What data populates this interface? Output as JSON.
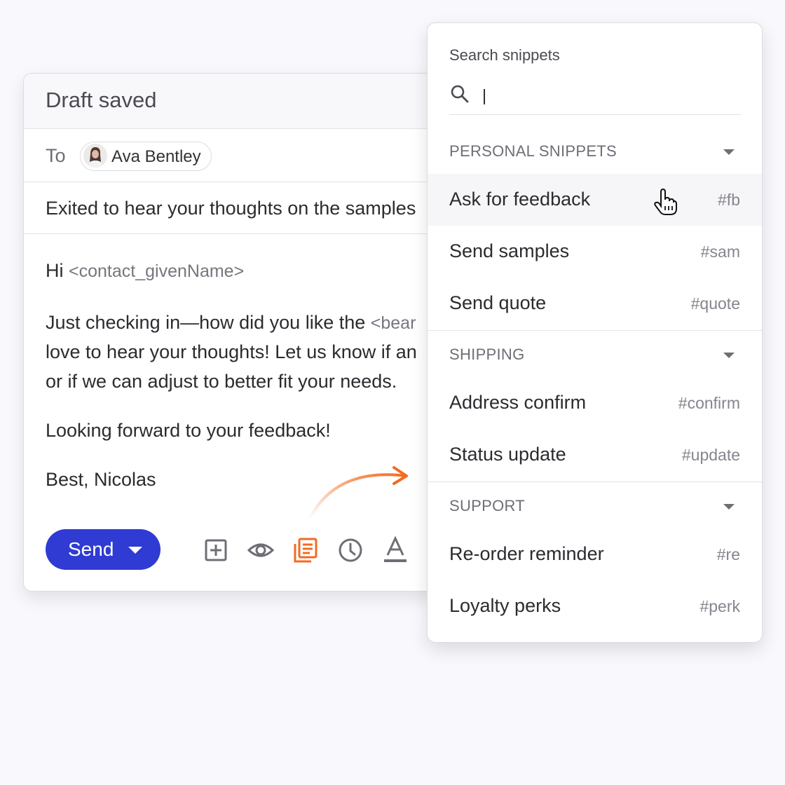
{
  "composer": {
    "status_title": "Draft saved",
    "to_label": "To",
    "recipient": {
      "name": "Ava Bentley",
      "avatar": "avatar-photo"
    },
    "subject": "Exited to hear your thoughts on the samples",
    "body": {
      "greeting": "Hi",
      "greeting_placeholder": "<contact_givenName>",
      "line1": "Just checking in—how did you like the",
      "line1_placeholder": "<bear",
      "line2": "love to hear your thoughts! Let us know if an",
      "line3": "or if we can adjust to better fit your needs.",
      "line4": "Looking forward to your feedback!",
      "signature": "Best, Nicolas"
    },
    "send_label": "Send",
    "toolbar": [
      {
        "icon": "insert-plus-icon"
      },
      {
        "icon": "preview-eye-icon"
      },
      {
        "icon": "snippets-icon",
        "active_color": "#f26b21"
      },
      {
        "icon": "schedule-clock-icon"
      },
      {
        "icon": "text-format-icon"
      }
    ]
  },
  "snippets": {
    "search_label": "Search snippets",
    "search_value": "",
    "sections": [
      {
        "title": "PERSONAL SNIPPETS",
        "items": [
          {
            "name": "Ask for feedback",
            "tag": "#fb",
            "hovered": true
          },
          {
            "name": "Send samples",
            "tag": "#sam"
          },
          {
            "name": "Send quote",
            "tag": "#quote"
          }
        ]
      },
      {
        "title": "SHIPPING",
        "items": [
          {
            "name": "Address confirm",
            "tag": "#confirm"
          },
          {
            "name": "Status update",
            "tag": "#update"
          }
        ]
      },
      {
        "title": "SUPPORT",
        "items": [
          {
            "name": "Re-order reminder",
            "tag": "#re"
          },
          {
            "name": "Loyalty perks",
            "tag": "#perk"
          }
        ]
      }
    ]
  },
  "colors": {
    "accent": "#2f3bd3",
    "highlight": "#f26b21",
    "background": "#f9f8fc"
  }
}
